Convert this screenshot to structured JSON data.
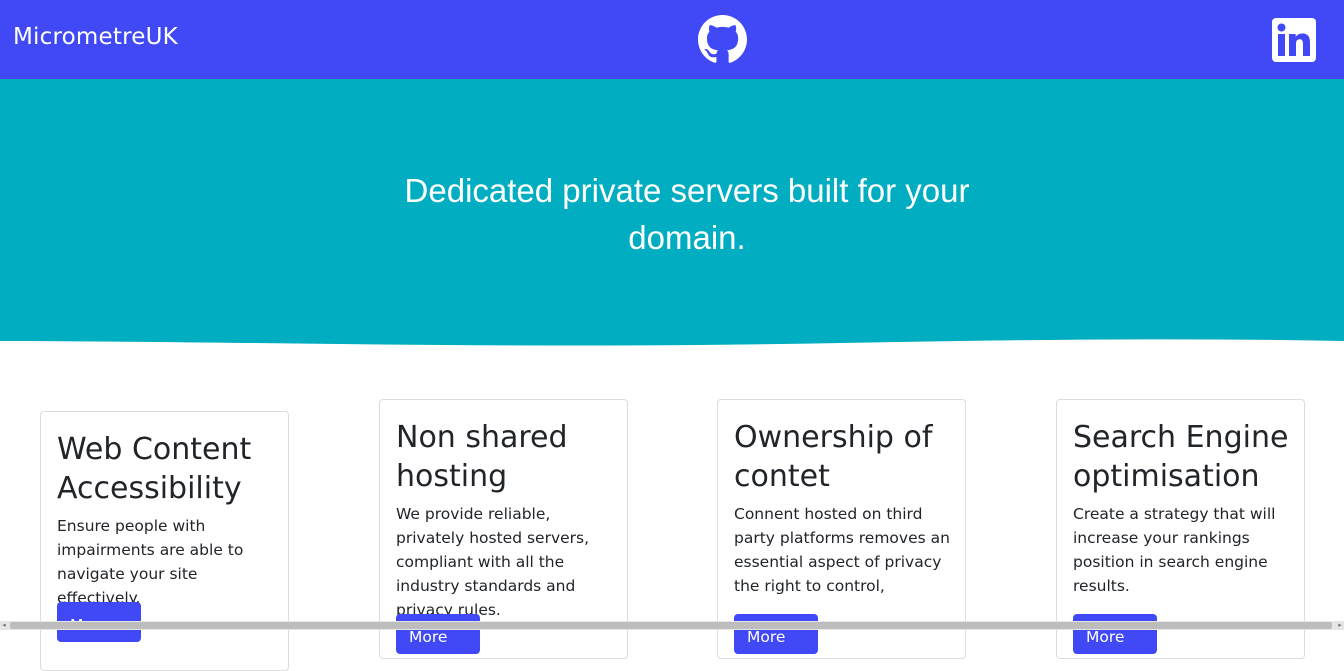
{
  "navbar": {
    "brand": "MicrometreUK",
    "github_icon": "github-icon",
    "linkedin_icon": "linkedin-icon",
    "colors": {
      "background": "#4149f7"
    }
  },
  "hero": {
    "headline": "Dedicated private servers built for your domain.",
    "colors": {
      "background": "#00adc1",
      "text": "#ffffff"
    }
  },
  "cards": [
    {
      "title": "Web Content Accessibility",
      "body": "Ensure people with impairments are able to navigate your site effectively.",
      "button_label": "More"
    },
    {
      "title": "Non shared hosting",
      "body": "We provide reliable, privately hosted servers, compliant with all the industry standards and privacy rules.",
      "button_label": "More"
    },
    {
      "title": "Ownership of contet",
      "body": "Connent hosted on third party platforms removes an essential aspect of privacy the right to control,",
      "button_label": "More"
    },
    {
      "title": "Search Engine optimisation",
      "body": "Create a strategy that will increase your rankings position in search engine results.",
      "button_label": "More"
    }
  ],
  "colors": {
    "accent": "#4149f7",
    "card_border": "#dcdcdc"
  }
}
